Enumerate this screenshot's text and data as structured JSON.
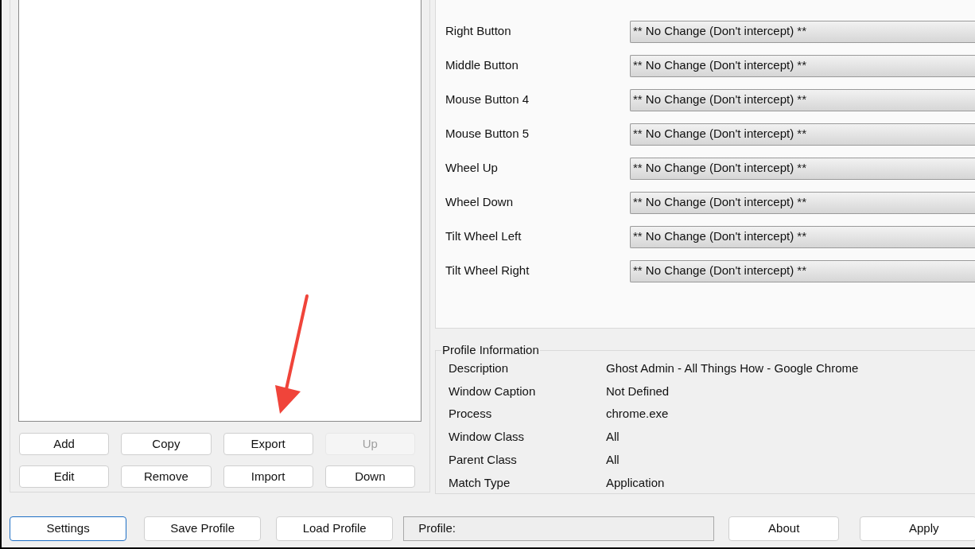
{
  "list_buttons": [
    {
      "label": "Add",
      "disabled": false
    },
    {
      "label": "Copy",
      "disabled": false
    },
    {
      "label": "Export",
      "disabled": false
    },
    {
      "label": "Up",
      "disabled": true
    },
    {
      "label": "Edit",
      "disabled": false
    },
    {
      "label": "Remove",
      "disabled": false
    },
    {
      "label": "Import",
      "disabled": false
    },
    {
      "label": "Down",
      "disabled": false
    }
  ],
  "mapping_rows": [
    {
      "label": "Right Button",
      "value": "** No Change (Don't intercept) **"
    },
    {
      "label": "Middle Button",
      "value": "** No Change (Don't intercept) **"
    },
    {
      "label": "Mouse Button 4",
      "value": "** No Change (Don't intercept) **"
    },
    {
      "label": "Mouse Button 5",
      "value": "** No Change (Don't intercept) **"
    },
    {
      "label": "Wheel Up",
      "value": "** No Change (Don't intercept) **"
    },
    {
      "label": "Wheel Down",
      "value": "** No Change (Don't intercept) **"
    },
    {
      "label": "Tilt Wheel Left",
      "value": "** No Change (Don't intercept) **"
    },
    {
      "label": "Tilt Wheel Right",
      "value": "** No Change (Don't intercept) **"
    }
  ],
  "profile_information": {
    "title": "Profile Information",
    "rows": [
      {
        "label": "Description",
        "value": "Ghost Admin - All Things How - Google Chrome"
      },
      {
        "label": "Window Caption",
        "value": "Not Defined"
      },
      {
        "label": "Process",
        "value": "chrome.exe"
      },
      {
        "label": "Window Class",
        "value": "All"
      },
      {
        "label": "Parent Class",
        "value": "All"
      },
      {
        "label": "Match Type",
        "value": "Application"
      }
    ]
  },
  "bottom_buttons": [
    {
      "label": "Settings",
      "focused": true
    },
    {
      "label": "Save Profile",
      "focused": false
    },
    {
      "label": "Load Profile",
      "focused": false
    }
  ],
  "profile_field": {
    "label": "Profile:"
  },
  "right_buttons": [
    {
      "label": "About"
    },
    {
      "label": "Apply"
    }
  ]
}
